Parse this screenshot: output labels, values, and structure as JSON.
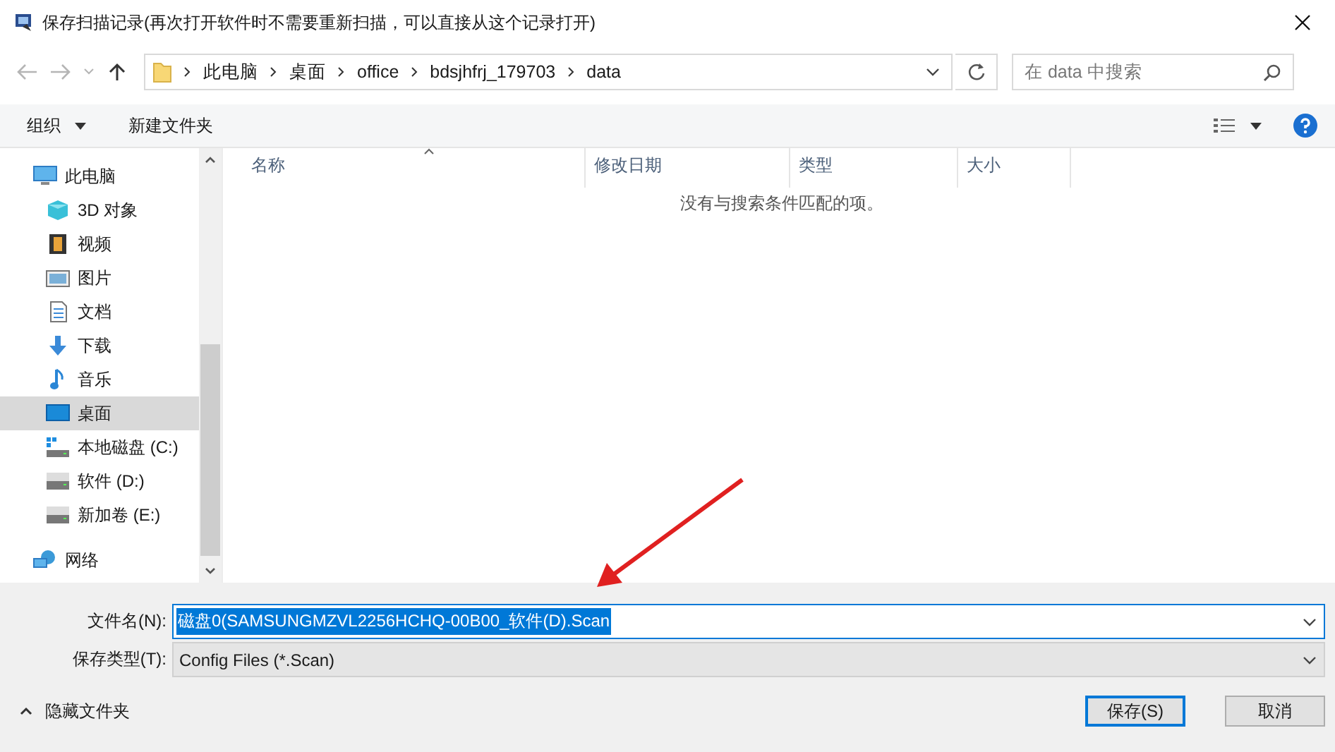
{
  "window": {
    "title": "保存扫描记录(再次打开软件时不需要重新扫描，可以直接从这个记录打开)"
  },
  "address": {
    "crumbs": [
      "此电脑",
      "桌面",
      "office",
      "bdsjhfrj_179703",
      "data"
    ]
  },
  "search": {
    "placeholder": "在 data 中搜索"
  },
  "toolbar": {
    "organize": "组织",
    "new_folder": "新建文件夹"
  },
  "nav": [
    {
      "label": "此电脑",
      "selected": false,
      "children": [
        {
          "label": "3D 对象",
          "selected": false
        },
        {
          "label": "视频",
          "selected": false
        },
        {
          "label": "图片",
          "selected": false
        },
        {
          "label": "文档",
          "selected": false
        },
        {
          "label": "下载",
          "selected": false
        },
        {
          "label": "音乐",
          "selected": false
        },
        {
          "label": "桌面",
          "selected": true
        },
        {
          "label": "本地磁盘 (C:)",
          "selected": false
        },
        {
          "label": "软件 (D:)",
          "selected": false
        },
        {
          "label": "新加卷 (E:)",
          "selected": false
        }
      ]
    },
    {
      "label": "网络",
      "selected": false
    }
  ],
  "table": {
    "columns": [
      "名称",
      "修改日期",
      "类型",
      "大小"
    ],
    "empty_message": "没有与搜索条件匹配的项。"
  },
  "filename": {
    "label": "文件名(N):",
    "value": "磁盘0(SAMSUNGMZVL2256HCHQ-00B00_软件(D).Scan"
  },
  "filetype": {
    "label": "保存类型(T):",
    "value": "Config Files (*.Scan)"
  },
  "hide_folders": "隐藏文件夹",
  "buttons": [
    "保存(S)",
    "取消"
  ]
}
